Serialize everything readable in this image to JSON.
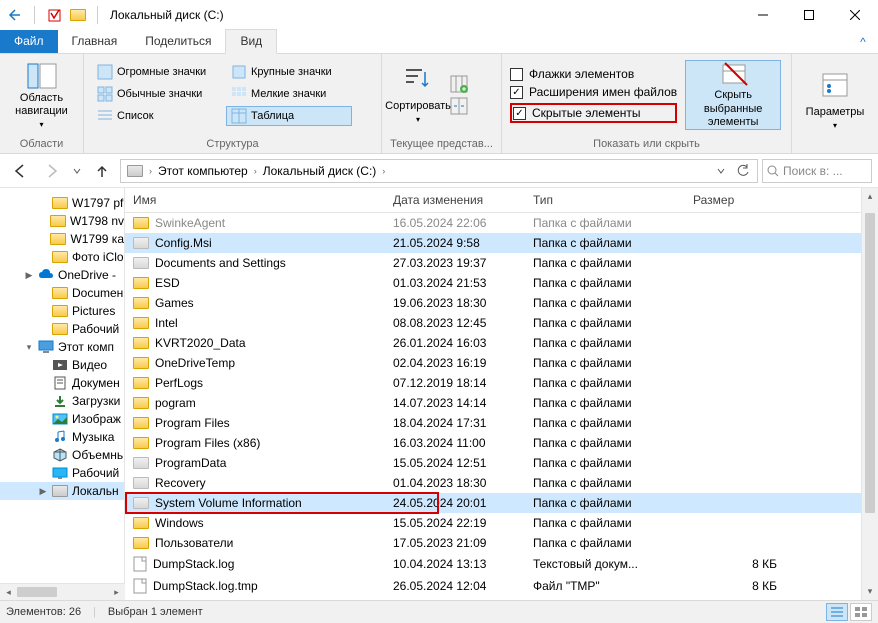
{
  "window": {
    "title": "Локальный диск (C:)"
  },
  "tabs": {
    "file": "Файл",
    "home": "Главная",
    "share": "Поделиться",
    "view": "Вид"
  },
  "ribbon": {
    "panes_label": "Области",
    "nav_pane": "Область навигации",
    "layout_label": "Структура",
    "layouts": {
      "xl": "Огромные значки",
      "lg": "Крупные значки",
      "md": "Обычные значки",
      "sm": "Мелкие значки",
      "list": "Список",
      "table": "Таблица"
    },
    "sort": "Сортировать",
    "current_view_label": "Текущее представ...",
    "cb_item_checkboxes": "Флажки элементов",
    "cb_extensions": "Расширения имен файлов",
    "cb_hidden": "Скрытые элементы",
    "hide_selected": "Скрыть выбранные элементы",
    "show_hide_label": "Показать или скрыть",
    "options": "Параметры"
  },
  "breadcrumb": {
    "root": "Этот компьютер",
    "drive": "Локальный диск (C:)"
  },
  "search": {
    "placeholder": "Поиск в: ..."
  },
  "nav": {
    "items": [
      {
        "label": "W1797 pf",
        "type": "folder",
        "indent": 2
      },
      {
        "label": "W1798 nv",
        "type": "folder",
        "indent": 2
      },
      {
        "label": "W1799 ка",
        "type": "folder",
        "indent": 2
      },
      {
        "label": "Фото iClo",
        "type": "folder",
        "indent": 2
      },
      {
        "label": "OneDrive -",
        "type": "cloud",
        "indent": 1,
        "caret": "▶"
      },
      {
        "label": "Documен",
        "type": "folder",
        "indent": 2
      },
      {
        "label": "Pictures",
        "type": "folder",
        "indent": 2
      },
      {
        "label": "Рабочий",
        "type": "folder",
        "indent": 2
      },
      {
        "label": "Этот комп",
        "type": "pc",
        "indent": 1,
        "caret": "▾"
      },
      {
        "label": "Видео",
        "type": "lib-video",
        "indent": 2
      },
      {
        "label": "Докумен",
        "type": "lib-doc",
        "indent": 2
      },
      {
        "label": "Загрузки",
        "type": "lib-dl",
        "indent": 2
      },
      {
        "label": "Изображ",
        "type": "lib-pic",
        "indent": 2
      },
      {
        "label": "Музыка",
        "type": "lib-music",
        "indent": 2
      },
      {
        "label": "Объемнь",
        "type": "lib-3d",
        "indent": 2
      },
      {
        "label": "Рабочий",
        "type": "lib-desk",
        "indent": 2
      },
      {
        "label": "Локальн",
        "type": "drive",
        "indent": 2,
        "selected": true,
        "caret": "▶"
      }
    ]
  },
  "columns": {
    "name": "Имя",
    "date": "Дата изменения",
    "type": "Тип",
    "size": "Размер"
  },
  "files": [
    {
      "name": "SwinkeAgent",
      "date": "16.05.2024 22:06",
      "type": "Папка с файлами",
      "size": "",
      "icon": "folder",
      "cut": true
    },
    {
      "name": "Config.Msi",
      "date": "21.05.2024 9:58",
      "type": "Папка с файлами",
      "size": "",
      "icon": "folder-gray",
      "selected_bg": true
    },
    {
      "name": "Documents and Settings",
      "date": "27.03.2023 19:37",
      "type": "Папка с файлами",
      "size": "",
      "icon": "folder-gray"
    },
    {
      "name": "ESD",
      "date": "01.03.2024 21:53",
      "type": "Папка с файлами",
      "size": "",
      "icon": "folder"
    },
    {
      "name": "Games",
      "date": "19.06.2023 18:30",
      "type": "Папка с файлами",
      "size": "",
      "icon": "folder"
    },
    {
      "name": "Intel",
      "date": "08.08.2023 12:45",
      "type": "Папка с файлами",
      "size": "",
      "icon": "folder"
    },
    {
      "name": "KVRT2020_Data",
      "date": "26.01.2024 16:03",
      "type": "Папка с файлами",
      "size": "",
      "icon": "folder"
    },
    {
      "name": "OneDriveTemp",
      "date": "02.04.2023 16:19",
      "type": "Папка с файлами",
      "size": "",
      "icon": "folder"
    },
    {
      "name": "PerfLogs",
      "date": "07.12.2019 18:14",
      "type": "Папка с файлами",
      "size": "",
      "icon": "folder"
    },
    {
      "name": "pogram",
      "date": "14.07.2023 14:14",
      "type": "Папка с файлами",
      "size": "",
      "icon": "folder"
    },
    {
      "name": "Program Files",
      "date": "18.04.2024 17:31",
      "type": "Папка с файлами",
      "size": "",
      "icon": "folder"
    },
    {
      "name": "Program Files (x86)",
      "date": "16.03.2024 11:00",
      "type": "Папка с файлами",
      "size": "",
      "icon": "folder"
    },
    {
      "name": "ProgramData",
      "date": "15.05.2024 12:51",
      "type": "Папка с файлами",
      "size": "",
      "icon": "folder-gray"
    },
    {
      "name": "Recovery",
      "date": "01.04.2023 18:30",
      "type": "Папка с файлами",
      "size": "",
      "icon": "folder-gray"
    },
    {
      "name": "System Volume Information",
      "date": "24.05.2024 20:01",
      "type": "Папка с файлами",
      "size": "",
      "icon": "folder-gray",
      "selected": true,
      "red": true
    },
    {
      "name": "Windows",
      "date": "15.05.2024 22:19",
      "type": "Папка с файлами",
      "size": "",
      "icon": "folder"
    },
    {
      "name": "Пользователи",
      "date": "17.05.2023 21:09",
      "type": "Папка с файлами",
      "size": "",
      "icon": "folder"
    },
    {
      "name": "DumpStack.log",
      "date": "10.04.2024 13:13",
      "type": "Текстовый докум...",
      "size": "8 КБ",
      "icon": "file"
    },
    {
      "name": "DumpStack.log.tmp",
      "date": "26.05.2024 12:04",
      "type": "Файл \"TMP\"",
      "size": "8 КБ",
      "icon": "file"
    }
  ],
  "status": {
    "count": "Элементов: 26",
    "selected": "Выбран 1 элемент"
  }
}
